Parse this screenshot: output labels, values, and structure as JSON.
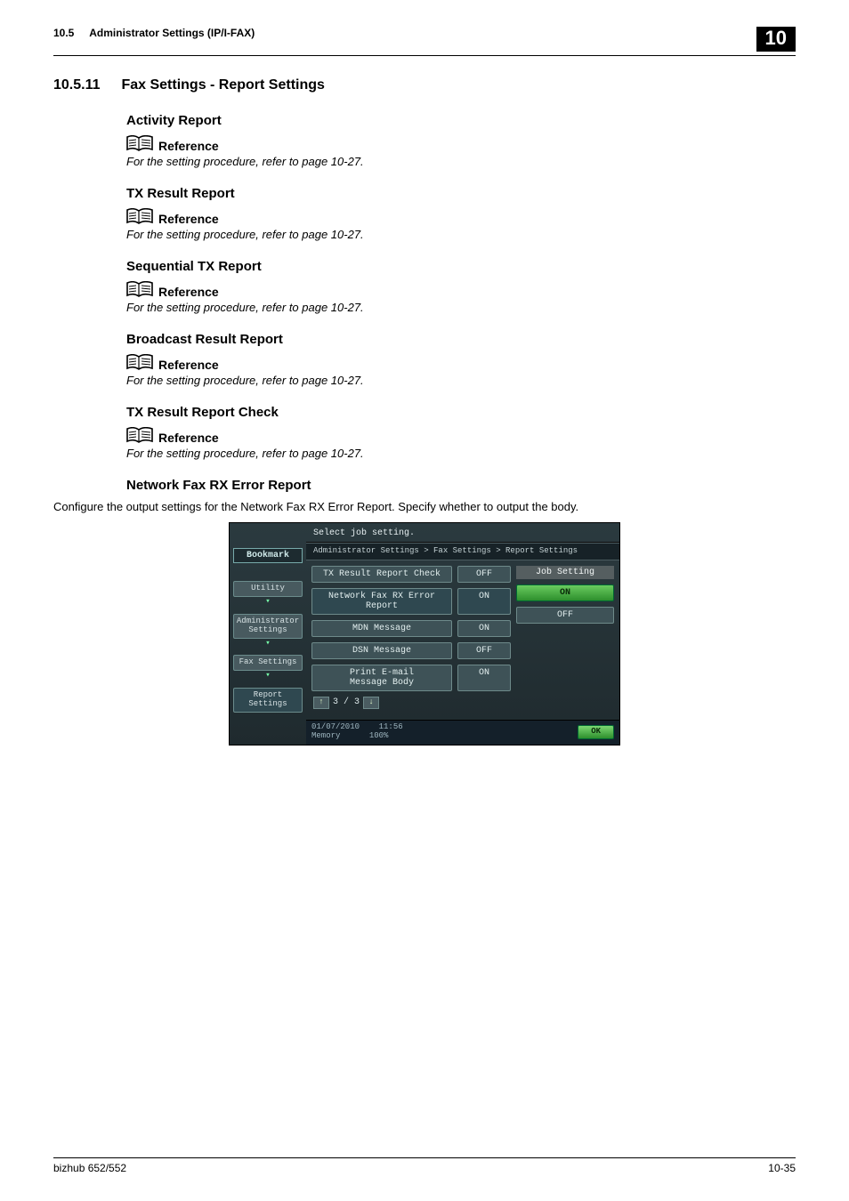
{
  "header": {
    "section_num": "10.5",
    "section_title": "Administrator Settings (IP/I-FAX)",
    "chapter": "10"
  },
  "main_heading": {
    "num": "10.5.11",
    "title": "Fax Settings - Report Settings"
  },
  "ref_label": "Reference",
  "ref_text": "For the setting procedure, refer to page 10-27.",
  "sections": {
    "activity": "Activity Report",
    "txres": "TX Result Report",
    "seqtx": "Sequential TX Report",
    "broad": "Broadcast Result Report",
    "txcheck": "TX Result Report Check",
    "netrx": "Network Fax RX Error Report"
  },
  "netrx_body": "Configure the output settings for the Network Fax RX Error Report. Specify whether to output the body.",
  "screenshot": {
    "title": "Select job setting.",
    "crumb": "Administrator Settings > Fax Settings > Report Settings",
    "bookmark": "Bookmark",
    "nav": {
      "utility": "Utility",
      "admin_l1": "Administrator",
      "admin_l2": "Settings",
      "fax": "Fax Settings",
      "report": "Report Settings"
    },
    "rows": {
      "r1": {
        "label": "TX Result Report Check",
        "val": "OFF"
      },
      "r2": {
        "label": "Network Fax RX Error Report",
        "val": "ON"
      },
      "r3": {
        "label": "MDN Message",
        "val": "ON"
      },
      "r4": {
        "label": "DSN Message",
        "val": "OFF"
      },
      "r5_l1": "Print E-mail",
      "r5_l2": "Message Body",
      "r5_val": "ON"
    },
    "opt_title": "Job Setting",
    "opt_on": "ON",
    "opt_off": "OFF",
    "page_ind": "3 /  3",
    "date": "01/07/2010",
    "time": "11:56",
    "mem_l": "Memory",
    "mem_v": "100%",
    "ok": "OK"
  },
  "footer": {
    "product": "bizhub 652/552",
    "pagenum": "10-35"
  }
}
